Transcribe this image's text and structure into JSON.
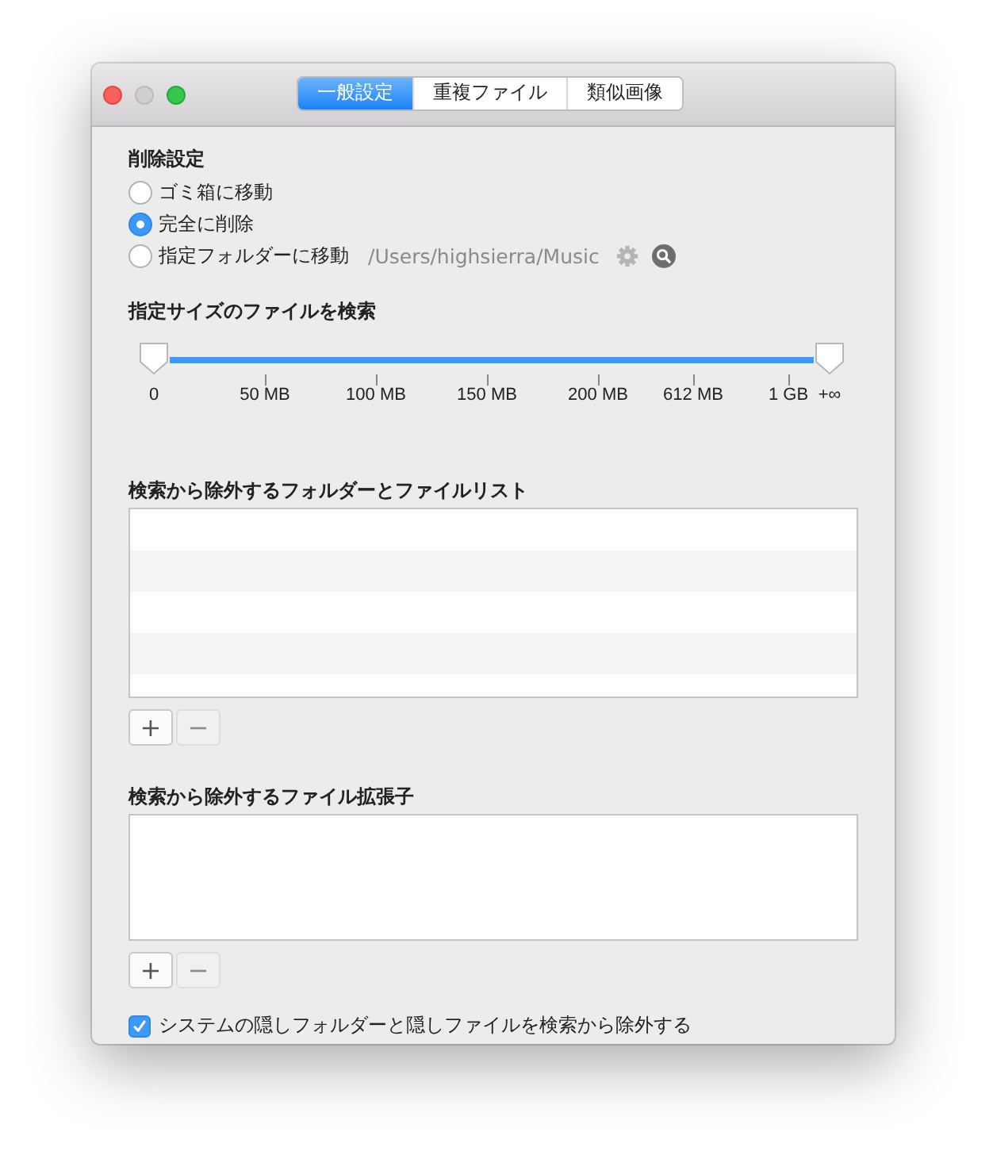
{
  "tabs": [
    {
      "label": "一般設定",
      "selected": true
    },
    {
      "label": "重複ファイル",
      "selected": false
    },
    {
      "label": "類似画像",
      "selected": false
    }
  ],
  "delete_settings": {
    "title": "削除設定",
    "options": [
      {
        "label": "ゴミ箱に移動",
        "selected": false
      },
      {
        "label": "完全に削除",
        "selected": true
      },
      {
        "label": "指定フォルダーに移動",
        "selected": false,
        "path": "/Users/highsierra/Music"
      }
    ]
  },
  "size_filter": {
    "title": "指定サイズのファイルを検索",
    "thumbs": [
      {
        "level": 0
      },
      {
        "level": 1
      }
    ],
    "labels": [
      "0",
      "50 MB",
      "100 MB",
      "150 MB",
      "200 MB",
      "612 MB",
      "1 GB",
      "+∞"
    ]
  },
  "excluded_folders": {
    "title": "検索から除外するフォルダーとファイルリスト",
    "buttons": [
      {
        "label": "+",
        "disabled": false
      },
      {
        "label": "−",
        "disabled": true
      }
    ]
  },
  "excluded_extensions": {
    "title": "検索から除外するファイル拡張子",
    "buttons": [
      {
        "label": "+",
        "disabled": false
      },
      {
        "label": "−",
        "disabled": true
      }
    ]
  },
  "hide_system": {
    "label": "システムの隠しフォルダーと隠しファイルを検索から除外する",
    "checked": true
  }
}
